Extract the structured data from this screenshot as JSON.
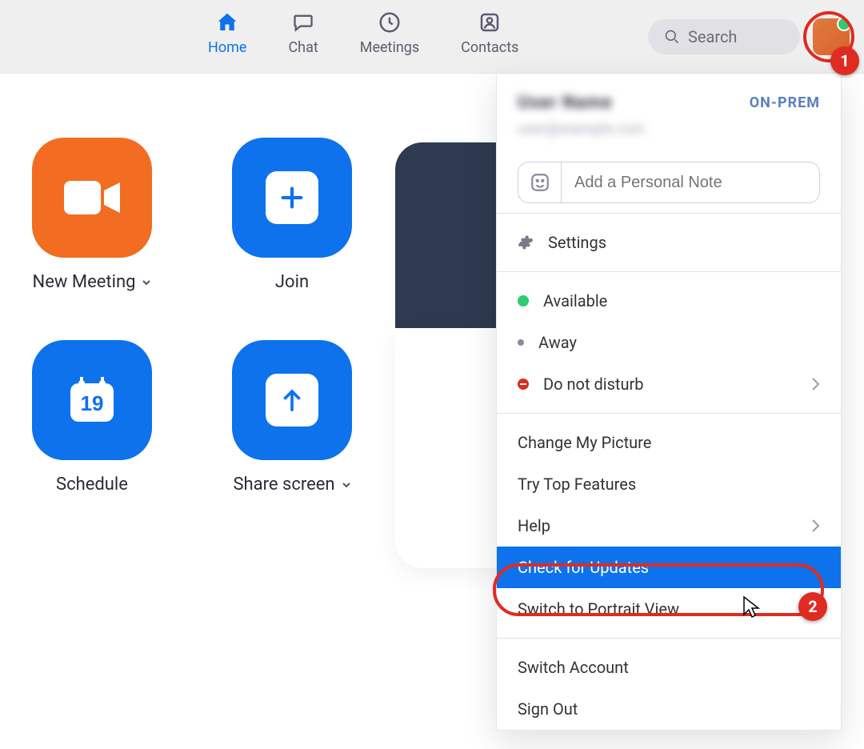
{
  "nav": {
    "items": [
      {
        "label": "Home",
        "active": true
      },
      {
        "label": "Chat",
        "active": false
      },
      {
        "label": "Meetings",
        "active": false
      },
      {
        "label": "Contacts",
        "active": false
      }
    ],
    "search_placeholder": "Search"
  },
  "actions": {
    "new_meeting": "New Meeting",
    "join": "Join",
    "schedule": "Schedule",
    "share": "Share screen",
    "schedule_day": "19"
  },
  "profile_menu": {
    "user_name": "User Name",
    "user_email": "user@example.com",
    "tag": "ON-PREM",
    "note_placeholder": "Add a Personal Note",
    "settings": "Settings",
    "status": {
      "available": "Available",
      "away": "Away",
      "dnd": "Do not disturb"
    },
    "items": {
      "change_picture": "Change My Picture",
      "try_top": "Try Top Features",
      "help": "Help",
      "check_updates": "Check for Updates",
      "portrait": "Switch to Portrait View",
      "switch_account": "Switch Account",
      "sign_out": "Sign Out"
    }
  },
  "annotations": {
    "step1": "1",
    "step2": "2"
  }
}
